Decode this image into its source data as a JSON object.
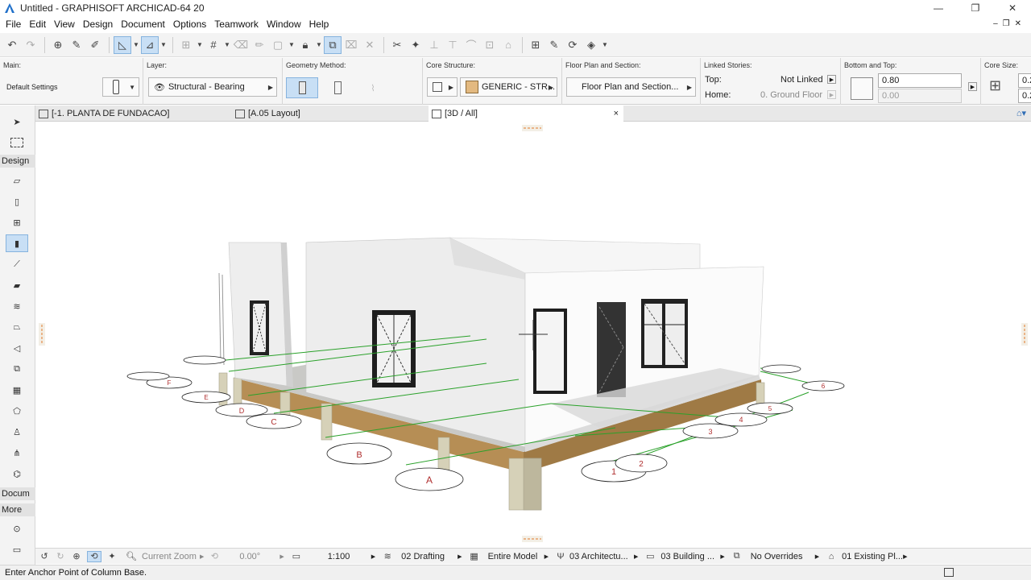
{
  "window": {
    "title": "Untitled - GRAPHISOFT ARCHICAD-64 20"
  },
  "menu": [
    "File",
    "Edit",
    "View",
    "Design",
    "Document",
    "Options",
    "Teamwork",
    "Window",
    "Help"
  ],
  "infobox": {
    "main": {
      "label": "Main:",
      "value": "Default Settings"
    },
    "layer": {
      "label": "Layer:",
      "value": "Structural - Bearing"
    },
    "geometry": {
      "label": "Geometry Method:"
    },
    "core": {
      "label": "Core Structure:",
      "value": "GENERIC - STR..."
    },
    "floorplan": {
      "label": "Floor Plan and Section:",
      "value": "Floor Plan and Section..."
    },
    "linked": {
      "label": "Linked Stories:",
      "top_label": "Top:",
      "top_value": "Not Linked",
      "home_label": "Home:",
      "home_value": "0. Ground Floor"
    },
    "bottomtop": {
      "label": "Bottom and Top:",
      "top": "0.80",
      "bottom": "0.00"
    },
    "coresize": {
      "label": "Core Size:",
      "v1": "0.2",
      "v2": "0.2"
    }
  },
  "tabs": [
    {
      "label": "[-1. PLANTA DE FUNDACAO]"
    },
    {
      "label": "[A.05 Layout]"
    },
    {
      "label": "[3D / All]",
      "close": "×"
    }
  ],
  "toolbox": {
    "design_label": "Design",
    "document_label": "Docum",
    "more_label": "More"
  },
  "gridmarkers": {
    "a": "A",
    "b": "B",
    "c": "C",
    "d": "D",
    "e": "E",
    "f": "F",
    "one": "1",
    "two": "2",
    "three": "3",
    "four": "4",
    "five": "5",
    "six": "6"
  },
  "navbar": {
    "zoom": "Current Zoom",
    "angle": "0.00°",
    "scale": "1:100",
    "layer_combo": "02 Drafting",
    "model_view": "Entire Model",
    "pen_set": "03 Architectu...",
    "mvo": "03 Building ...",
    "overrides": "No Overrides",
    "renovation": "01 Existing Pl..."
  },
  "status": "Enter Anchor Point of Column Base.",
  "colors": {
    "selection": "#c8dff5",
    "grid": "#2aa12a",
    "slab": "#b68e55",
    "wall": "#f0f0f0"
  }
}
